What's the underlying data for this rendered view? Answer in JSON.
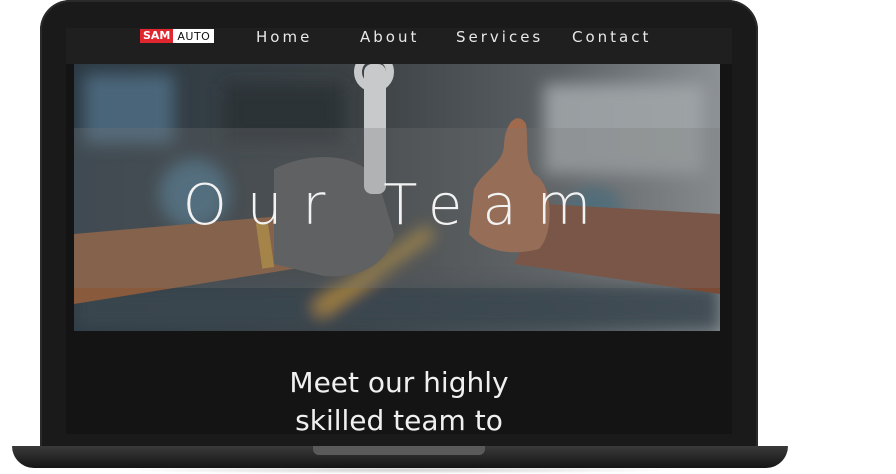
{
  "site": {
    "logo": {
      "primary": "SAM",
      "secondary": "AUTO"
    },
    "nav": [
      {
        "label": "Home"
      },
      {
        "label": "About"
      },
      {
        "label": "Services"
      },
      {
        "label": "Contact"
      }
    ],
    "hero": {
      "title": "Our Team"
    },
    "intro": {
      "line1": "Meet our highly",
      "line2": "skilled team to"
    }
  },
  "colors": {
    "brand_red": "#e0262e",
    "page_bg": "#141414",
    "nav_bg": "#1f1f1f"
  }
}
